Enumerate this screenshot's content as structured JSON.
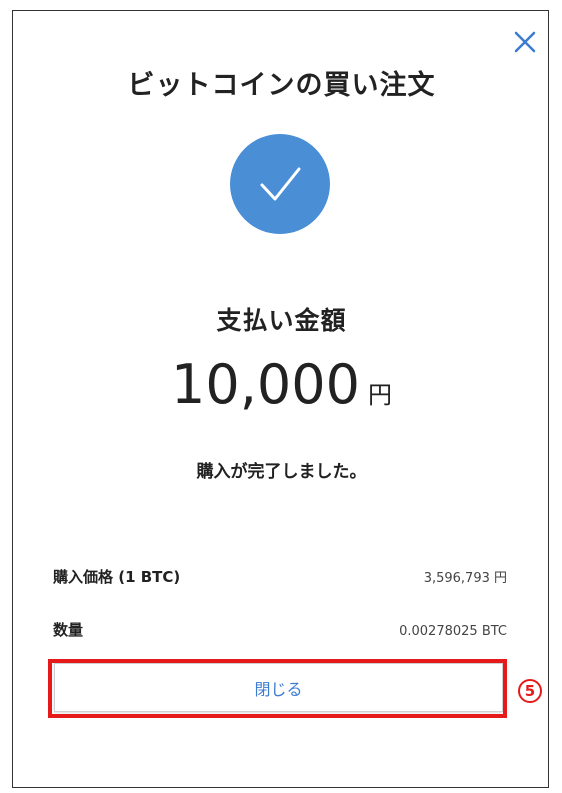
{
  "dialog": {
    "title": "ビットコインの買い注文",
    "close_icon": "close-icon",
    "status_icon": "checkmark-icon",
    "status_color": "#4a8fd6"
  },
  "payment": {
    "label": "支払い金額",
    "amount": "10,000",
    "unit": "円",
    "message": "購入が完了しました。"
  },
  "details": [
    {
      "label": "購入価格 (1 BTC)",
      "value": "3,596,793 円"
    },
    {
      "label": "数量",
      "value": "0.00278025 BTC"
    }
  ],
  "actions": {
    "close_label": "閉じる",
    "close_label_color": "#3b7bd0"
  },
  "annotation": {
    "step_number": "5",
    "highlight_color": "#e61a1a"
  }
}
